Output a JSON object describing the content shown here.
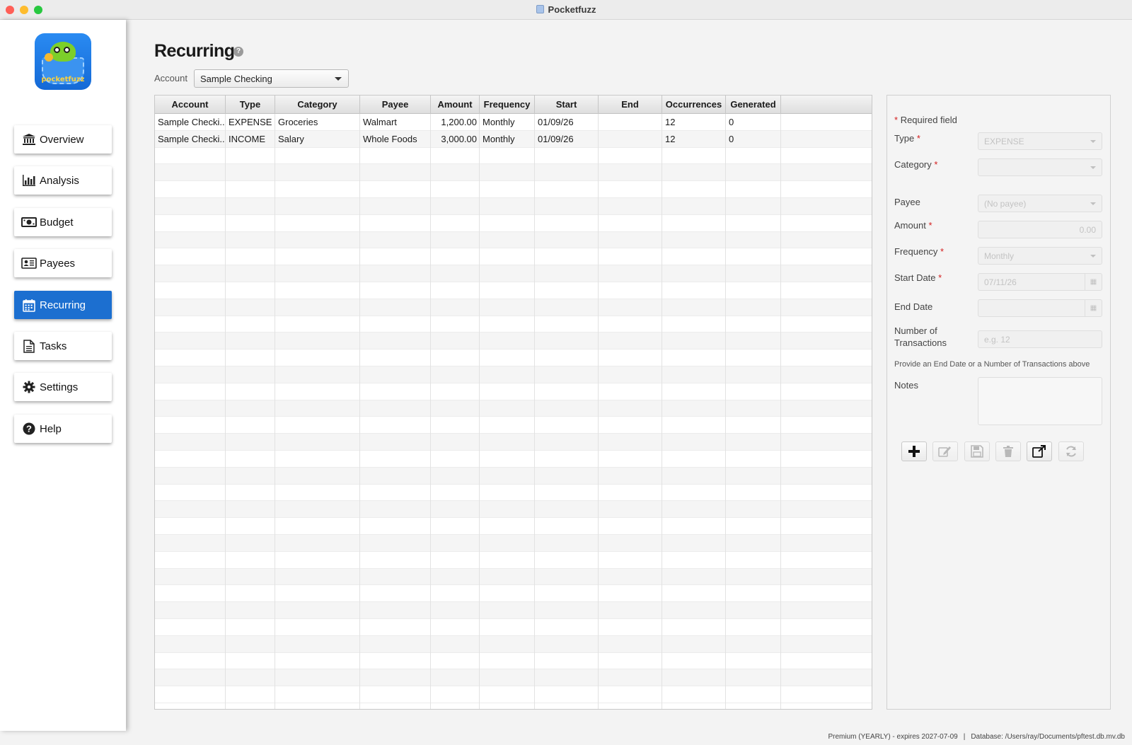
{
  "window": {
    "title": "Pocketfuzz"
  },
  "logo": {
    "text": "pocketfuzz"
  },
  "sidebar": {
    "items": [
      {
        "label": "Overview",
        "icon": "bank-icon"
      },
      {
        "label": "Analysis",
        "icon": "bar-chart-icon"
      },
      {
        "label": "Budget",
        "icon": "money-icon"
      },
      {
        "label": "Payees",
        "icon": "address-card-icon"
      },
      {
        "label": "Recurring",
        "icon": "calendar-icon",
        "active": true
      },
      {
        "label": "Tasks",
        "icon": "document-icon"
      },
      {
        "label": "Settings",
        "icon": "gear-icon"
      },
      {
        "label": "Help",
        "icon": "help-circle-icon"
      }
    ]
  },
  "page": {
    "title": "Recurring",
    "help_glyph": "?"
  },
  "account_filter": {
    "label": "Account",
    "value": "Sample Checking"
  },
  "table": {
    "columns": [
      "Account",
      "Type",
      "Category",
      "Payee",
      "Amount",
      "Frequency",
      "Start",
      "End",
      "Occurrences",
      "Generated"
    ],
    "rows": [
      [
        "Sample Checki...",
        "EXPENSE",
        "Groceries",
        "Walmart",
        "1,200.00",
        "Monthly",
        "01/09/26",
        "",
        "12",
        "0"
      ],
      [
        "Sample Checki...",
        "INCOME",
        "Salary",
        "Whole Foods",
        "3,000.00",
        "Monthly",
        "01/09/26",
        "",
        "12",
        "0"
      ]
    ]
  },
  "form": {
    "required_marker": "*",
    "required_note": "Required field",
    "type_label": "Type",
    "type_value": "EXPENSE",
    "category_label": "Category",
    "category_value": "",
    "payee_label": "Payee",
    "payee_value": "(No payee)",
    "amount_label": "Amount",
    "amount_value": "0.00",
    "frequency_label": "Frequency",
    "frequency_value": "Monthly",
    "start_label": "Start Date",
    "start_value": "07/11/26",
    "end_label": "End Date",
    "end_value": "",
    "count_label_1": "Number of",
    "count_label_2": "Transactions",
    "count_placeholder": "e.g. 12",
    "hint": "Provide an End Date or a Number of Transactions above",
    "notes_label": "Notes"
  },
  "actions": [
    {
      "name": "add-button",
      "icon": "plus-icon",
      "enabled": true
    },
    {
      "name": "edit-button",
      "icon": "edit-icon",
      "enabled": false
    },
    {
      "name": "save-button",
      "icon": "save-icon",
      "enabled": false
    },
    {
      "name": "delete-button",
      "icon": "trash-icon",
      "enabled": false
    },
    {
      "name": "open-external-button",
      "icon": "external-link-icon",
      "enabled": true
    },
    {
      "name": "refresh-button",
      "icon": "refresh-icon",
      "enabled": false
    }
  ],
  "status": {
    "license": "Premium (YEARLY) - expires 2027-07-09",
    "separator": "|",
    "database": "Database: /Users/ray/Documents/pftest.db.mv.db"
  },
  "colors": {
    "accent": "#1c6fd0",
    "required": "#d42020"
  }
}
